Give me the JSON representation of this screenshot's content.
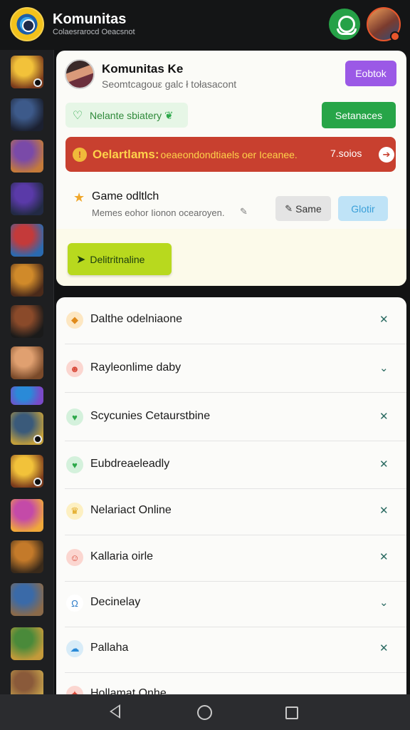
{
  "header": {
    "app_title": "Komunitas",
    "app_subtitle": "Colaesrarocd Oeacsnot"
  },
  "sidebar": {
    "games": [
      {
        "name": "golden-helmet-hero",
        "c1": "#f2c23a",
        "c2": "#7a3a1c",
        "badge": true
      },
      {
        "name": "blue-mech",
        "c1": "#3d5a8a",
        "c2": "#1b2030",
        "badge": false
      },
      {
        "name": "purple-warrior",
        "c1": "#7a4aa8",
        "c2": "#c47a3a",
        "badge": false
      },
      {
        "name": "violet-gunner",
        "c1": "#5a3aa8",
        "c2": "#222a44",
        "badge": false
      },
      {
        "name": "red-knight",
        "c1": "#c43a3a",
        "c2": "#2a6ab0",
        "badge": false
      },
      {
        "name": "crossed-blades",
        "c1": "#d08a2a",
        "c2": "#4a2a1a",
        "badge": false
      },
      {
        "name": "dark-rifle",
        "c1": "#8a4a2a",
        "c2": "#1a1a1a",
        "badge": false
      },
      {
        "name": "brawler",
        "c1": "#e0a070",
        "c2": "#7a4a2a",
        "badge": false
      },
      {
        "name": "blue-emblem",
        "c1": "#2a8ad8",
        "c2": "#7a4ac8",
        "badge": false
      },
      {
        "name": "steel-mech",
        "c1": "#3a5a7a",
        "c2": "#c4a03a",
        "badge": true
      },
      {
        "name": "golden-helmet-hero-2",
        "c1": "#f2c23a",
        "c2": "#7a3a1c",
        "badge": true
      },
      {
        "name": "pink-heroine",
        "c1": "#c44aa8",
        "c2": "#f0a83a",
        "badge": false
      },
      {
        "name": "copper-rifle",
        "c1": "#c47a2a",
        "c2": "#3a2a1a",
        "badge": false
      },
      {
        "name": "armored-soldier",
        "c1": "#3a6aa8",
        "c2": "#8a6a4a",
        "badge": false
      },
      {
        "name": "green-ranger",
        "c1": "#4a8a3a",
        "c2": "#c49a3a",
        "badge": false
      },
      {
        "name": "dwarf-viking",
        "c1": "#8a5a3a",
        "c2": "#c4a04a",
        "badge": false
      }
    ]
  },
  "card": {
    "title": "Komunitas Ke",
    "subtitle": "Seomtcagouε ɡalc ł tołasacont",
    "top_button": "Eobtok",
    "status_label": "Nelante sbiatery",
    "status_button": "Setanaces",
    "alert": {
      "title": "Oelartlams:",
      "text": "oeaeondondtiaels oer Iceanee.",
      "count": "7.soios"
    },
    "game": {
      "title": "Game odltlch",
      "description": "Memes eohor Iionon ocearoyen.",
      "button_secondary": "Same",
      "button_secondary_icon": "person-icon",
      "button_tertiary": "Glotir",
      "primary_action": "Delitritnaline"
    },
    "colors": {
      "purple": "#9b59e6",
      "green": "#27a548",
      "alert_red": "#c8402f",
      "alert_text": "#ffd24a",
      "lime": "#b8d91e",
      "light_blue": "#bfe3f7"
    }
  },
  "list": {
    "items": [
      {
        "label": "Dalthe odelniaone",
        "icon": "shield-icon",
        "glyph": "◆",
        "bg": "#fde7c2",
        "fg": "#e08a1a",
        "chevron": "✕"
      },
      {
        "label": "Rayleonlime daby",
        "icon": "face-icon",
        "glyph": "☻",
        "bg": "#fbd6d0",
        "fg": "#d94a3a",
        "chevron": "⌄"
      },
      {
        "label": "Scycunies Cetaurstbine",
        "icon": "heart-check-icon",
        "glyph": "♥",
        "bg": "#d4f1dc",
        "fg": "#2ca84a",
        "chevron": "✕"
      },
      {
        "label": "Eubdreaeleadly",
        "icon": "heart-check-icon",
        "glyph": "♥",
        "bg": "#d4f1dc",
        "fg": "#2ca84a",
        "chevron": "✕"
      },
      {
        "label": "Nelariact Online",
        "icon": "crown-icon",
        "glyph": "♛",
        "bg": "#fdf0c2",
        "fg": "#e0a51a",
        "chevron": "✕"
      },
      {
        "label": "Kallaria oirle",
        "icon": "ghost-icon",
        "glyph": "☺",
        "bg": "#fbd6d0",
        "fg": "#d94a3a",
        "chevron": "✕"
      },
      {
        "label": "Decinelay",
        "icon": "magnet-icon",
        "glyph": "Ω",
        "bg": "#ffffff",
        "fg": "#2a7ac8",
        "chevron": "⌄"
      },
      {
        "label": "Pallaha",
        "icon": "cloud-icon",
        "glyph": "☁",
        "bg": "#d8ecf8",
        "fg": "#2a8ad8",
        "chevron": "✕"
      },
      {
        "label": "Hollamat Onhe",
        "icon": "flame-icon",
        "glyph": "✦",
        "bg": "#fbd6d0",
        "fg": "#d94a3a",
        "chevron": "⌄"
      }
    ]
  }
}
